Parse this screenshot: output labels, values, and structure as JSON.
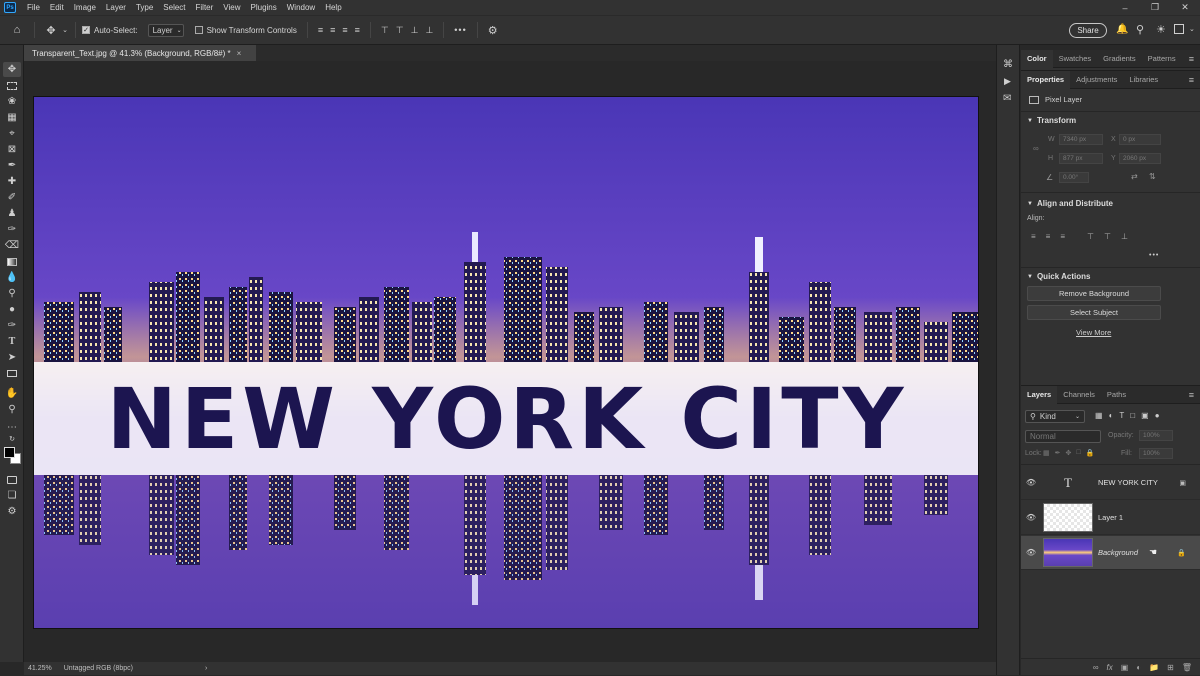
{
  "app": {
    "logo": "Ps",
    "menu": [
      "File",
      "Edit",
      "Image",
      "Layer",
      "Type",
      "Select",
      "Filter",
      "View",
      "Plugins",
      "Window",
      "Help"
    ]
  },
  "options": {
    "auto_select_label": "Auto-Select:",
    "auto_select_value": "Layer",
    "transform_controls_label": "Show Transform Controls",
    "share_label": "Share",
    "more": "•••"
  },
  "document": {
    "tab_title": "Transparent_Text.jpg @ 41.3% (Background, RGB/8#) *",
    "close": "×",
    "overlay_text": "NEW YORK CITY"
  },
  "status": {
    "zoom": "41.25%",
    "profile": "Untagged RGB (8bpc)",
    "arrow": "›"
  },
  "panels": {
    "color_tabs": [
      "Color",
      "Swatches",
      "Gradients",
      "Patterns"
    ],
    "props_tabs": [
      "Properties",
      "Adjustments",
      "Libraries"
    ],
    "pixel_layer": "Pixel Layer",
    "transform": {
      "title": "Transform",
      "w_label": "W",
      "w_value": "7340 px",
      "x_label": "X",
      "x_value": "0 px",
      "h_label": "H",
      "h_value": "877 px",
      "y_label": "Y",
      "y_value": "2060 px",
      "angle_value": "0.00°"
    },
    "align": {
      "title": "Align and Distribute",
      "label": "Align:",
      "more": "•••"
    },
    "quick_actions": {
      "title": "Quick Actions",
      "remove_bg": "Remove Background",
      "select_subject": "Select Subject",
      "view_more": "View More"
    },
    "layers": {
      "tabs": [
        "Layers",
        "Channels",
        "Paths"
      ],
      "kind": "Kind",
      "blend": "Normal",
      "opacity_label": "Opacity:",
      "opacity_value": "100%",
      "lock_label": "Lock:",
      "fill_label": "Fill:",
      "fill_value": "100%",
      "items": [
        {
          "name": "NEW YORK CITY",
          "type": "text",
          "type_glyph": "T"
        },
        {
          "name": "Layer 1",
          "type": "pixel"
        },
        {
          "name": "Background",
          "type": "image",
          "locked": true
        }
      ]
    }
  },
  "colors": {
    "accent": "#31a8ff",
    "panel_bg": "#323232",
    "app_bg": "#282828"
  }
}
